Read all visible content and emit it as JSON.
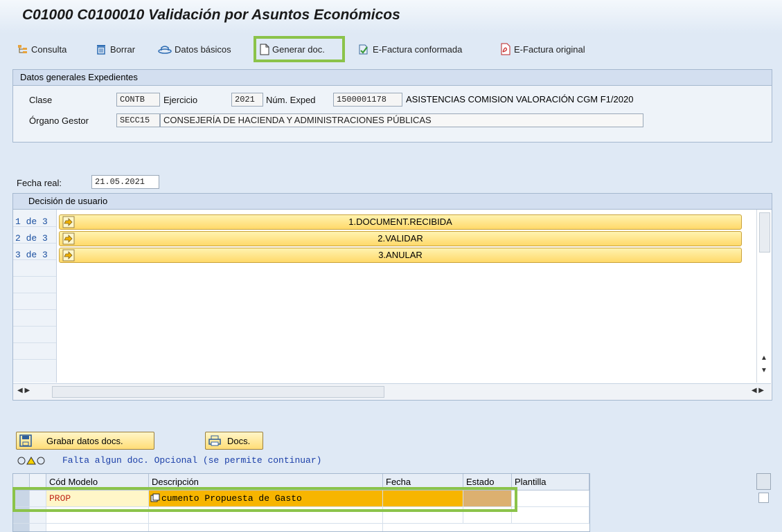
{
  "window": {
    "title": "C01000 C0100010 Validación por Asuntos Económicos"
  },
  "toolbar": {
    "consulta": "Consulta",
    "borrar": "Borrar",
    "datos_basicos": "Datos básicos",
    "generar_doc": "Generar doc.",
    "efactura_conformada": "E-Factura conformada",
    "efactura_original": "E-Factura original"
  },
  "datos_generales": {
    "header": "Datos generales Expedientes",
    "clase_label": "Clase",
    "clase_value": "CONTB",
    "ejercicio_label": "Ejercicio",
    "ejercicio_value": "2021",
    "num_exped_label": "Núm. Exped",
    "num_exped_value": "1500001178",
    "exped_desc": "ASISTENCIAS COMISION VALORACIÓN CGM F1/2020",
    "organo_label": "Órgano Gestor",
    "organo_value": "SECC15",
    "organo_desc": "CONSEJERÍA DE HACIENDA Y ADMINISTRACIONES PÚBLICAS"
  },
  "fecha": {
    "label": "Fecha real:",
    "value": "21.05.2021"
  },
  "decision": {
    "header": "Decisión de usuario",
    "options": [
      {
        "num": "1 de 3",
        "label": "1.DOCUMENT.RECIBIDA"
      },
      {
        "num": "2 de 3",
        "label": "2.VALIDAR"
      },
      {
        "num": "3 de 3",
        "label": "3.ANULAR"
      }
    ]
  },
  "buttons": {
    "grabar": "Grabar datos docs.",
    "docs": "Docs."
  },
  "message": "Falta algun doc. Opcional (se permite continuar)",
  "table": {
    "columns": [
      "Cód Modelo",
      "Descripción",
      "Fecha",
      "Estado",
      "Plantilla"
    ],
    "rows": [
      {
        "cod": "PROP",
        "desc": "cumento Propuesta de Gasto",
        "fecha": "",
        "estado": "",
        "plantilla": ""
      }
    ]
  },
  "colors": {
    "highlight": "#8bc34a",
    "choice_bg": "#ffd96a",
    "row_selected": "#f7b500",
    "message": "#1a3ea8"
  }
}
